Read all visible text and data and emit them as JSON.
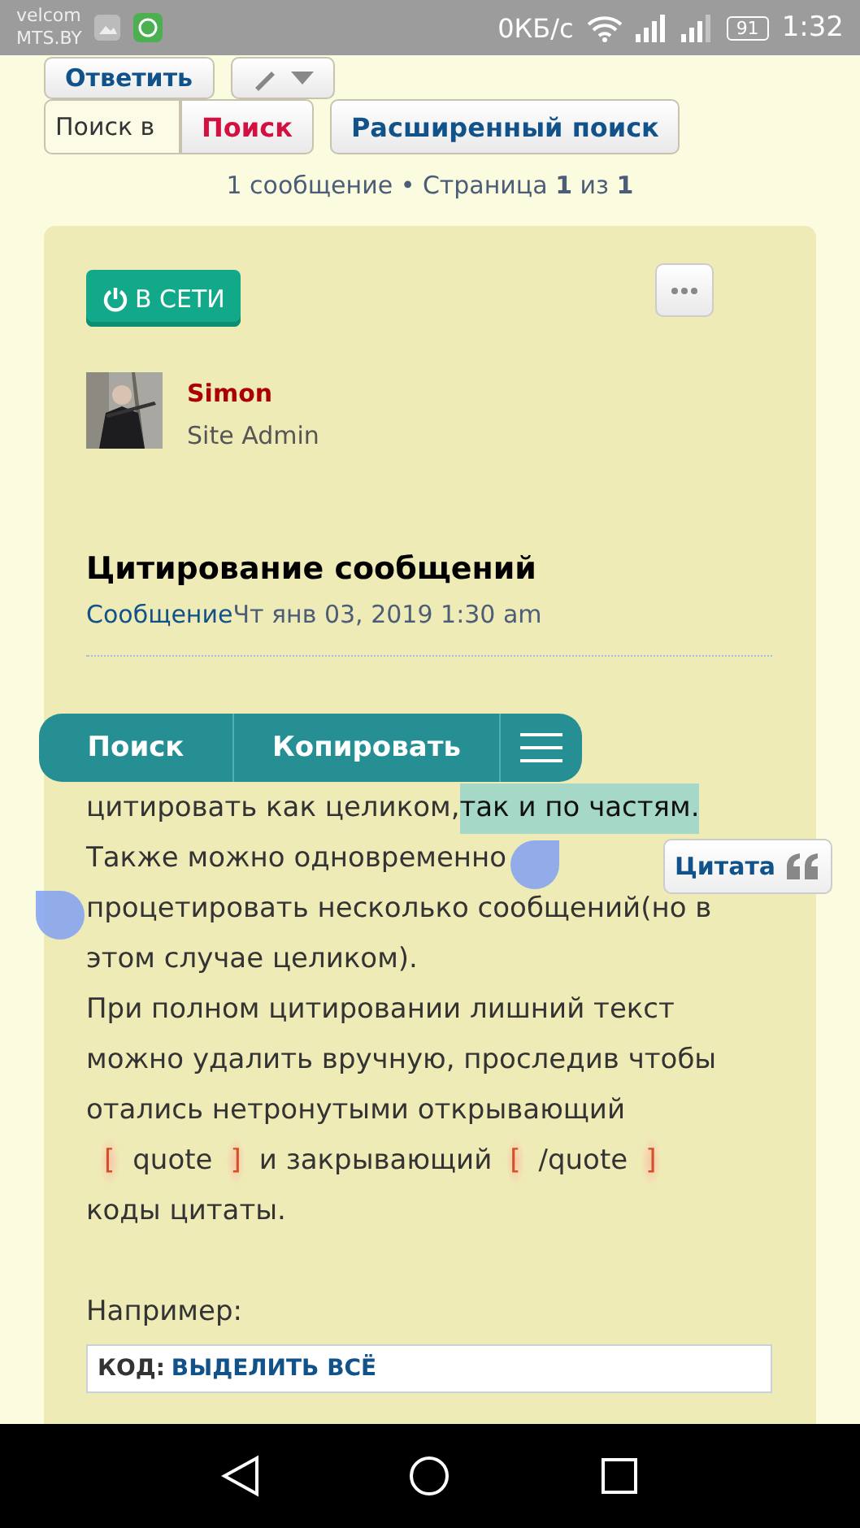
{
  "status_bar": {
    "carrier": [
      "velcom",
      "MTS.BY"
    ],
    "speed": "0КБ/с",
    "battery": "91",
    "time": "1:32"
  },
  "actions": {
    "reply": "Ответить"
  },
  "search": {
    "placeholder": "Поиск в",
    "button": "Поиск",
    "advanced": "Расширенный поиск"
  },
  "pagination": "1 сообщение • Страница **1** из **1**",
  "post": {
    "online_badge": "В СЕТИ",
    "author": "Simon",
    "rank": "Site Admin",
    "title": "Цитирование сообщений",
    "meta_link": "Сообщение",
    "meta_date": "Чт янв 03, 2019 1:30 am",
    "lines": [
      [
        {
          "kind": "text",
          "text": "цитировать как целиком, "
        },
        {
          "kind": "selected",
          "text": "так и по частям."
        }
      ],
      [
        {
          "kind": "text",
          "text": "Также можно одновременно"
        }
      ],
      [
        {
          "kind": "text",
          "text": "процетировать несколько сообщений(но в"
        }
      ],
      [
        {
          "kind": "text",
          "text": "этом случае целиком)."
        }
      ],
      [
        {
          "kind": "text",
          "text": "При полном цитировании лишний текст"
        }
      ],
      [
        {
          "kind": "text",
          "text": "можно удалить вручную, проследив чтобы"
        }
      ],
      [
        {
          "kind": "text",
          "text": "отались нетронутыми открывающий"
        }
      ],
      [
        {
          "kind": "bracket",
          "text": "["
        },
        {
          "kind": "text",
          "text": "quote"
        },
        {
          "kind": "bracket",
          "text": "]"
        },
        {
          "kind": "text",
          "text": "и закрывающий"
        },
        {
          "kind": "bracket",
          "text": "["
        },
        {
          "kind": "text",
          "text": "/quote"
        },
        {
          "kind": "bracket",
          "text": "]"
        }
      ],
      [
        {
          "kind": "text",
          "text": "коды цитаты."
        }
      ]
    ],
    "example_label": "Например:",
    "code": {
      "label": "КОД:",
      "link": "ВЫДЕЛИТЬ ВСЁ"
    }
  },
  "selection_toolbar": {
    "items": [
      "Поиск",
      "Копировать"
    ]
  },
  "quote_button": "Цитата"
}
